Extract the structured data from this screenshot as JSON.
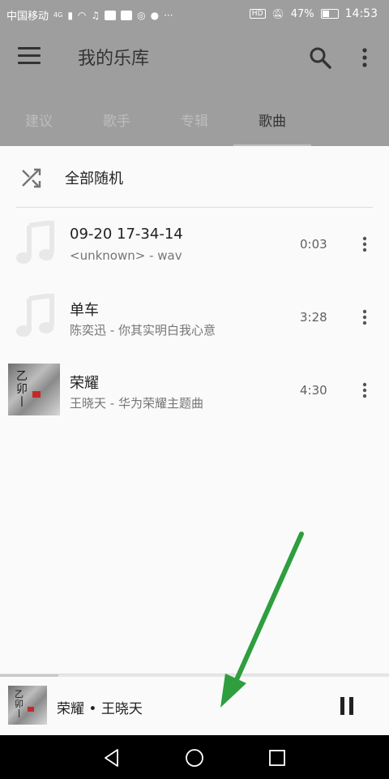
{
  "status_bar": {
    "carrier": "中国移动",
    "network": "4G",
    "hd": "HD",
    "battery": "47%",
    "time": "14:53",
    "icons": [
      "signal-icon",
      "wifi-icon",
      "music-icon",
      "baidu-icon",
      "mute-icon",
      "battery-icon"
    ]
  },
  "app_bar": {
    "title": "我的乐库",
    "icons": [
      "menu-icon",
      "search-icon",
      "more-vert-icon"
    ]
  },
  "tabs": [
    {
      "label": "建议",
      "active": false
    },
    {
      "label": "歌手",
      "active": false
    },
    {
      "label": "专辑",
      "active": false
    },
    {
      "label": "歌曲",
      "active": true
    }
  ],
  "shuffle": {
    "label": "全部随机",
    "icon": "shuffle-icon"
  },
  "songs": [
    {
      "title": "09-20 17-34-14",
      "subtitle": "<unknown> - wav",
      "duration": "0:03",
      "art": "music-note-icon"
    },
    {
      "title": "单车",
      "subtitle": "陈奕迅 - 你其实明白我心意",
      "duration": "3:28",
      "art": "music-note-icon"
    },
    {
      "title": "荣耀",
      "subtitle": "王晓天 - 华为荣耀主题曲",
      "duration": "4:30",
      "art": "album-art"
    }
  ],
  "mini_player": {
    "title": "荣耀 • 王晓天",
    "progress": 0.15,
    "icons": [
      "pause-icon"
    ]
  },
  "colors": {
    "appbar_bg": "#9e9e9e",
    "arrow": "#2e9e3f",
    "content_bg": "#fafafa"
  }
}
